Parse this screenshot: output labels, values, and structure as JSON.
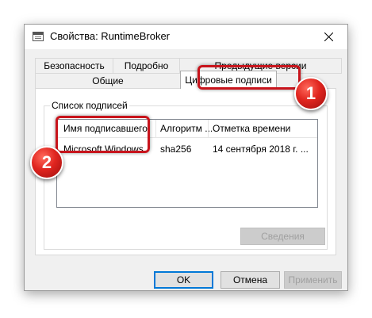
{
  "window": {
    "title": "Свойства: RuntimeBroker"
  },
  "tabs": {
    "security": "Безопасность",
    "details": "Подробно",
    "previous_versions": "Предыдущие версии",
    "general": "Общие",
    "digital_signatures": "Цифровые подписи"
  },
  "signatures": {
    "group_label": "Список подписей",
    "columns": [
      "Имя подписавшего",
      "Алгоритм ...",
      "Отметка времени"
    ],
    "rows": [
      {
        "signer": "Microsoft Windows",
        "algorithm": "sha256",
        "timestamp": "14 сентября 2018 г. ..."
      }
    ],
    "details_button": "Сведения"
  },
  "buttons": {
    "ok": "OK",
    "cancel": "Отмена",
    "apply": "Применить"
  },
  "annotations": {
    "badge1": "1",
    "badge2": "2"
  },
  "colors": {
    "highlight": "#c8141c",
    "badge": "#e0251f",
    "focus": "#0078d7"
  }
}
